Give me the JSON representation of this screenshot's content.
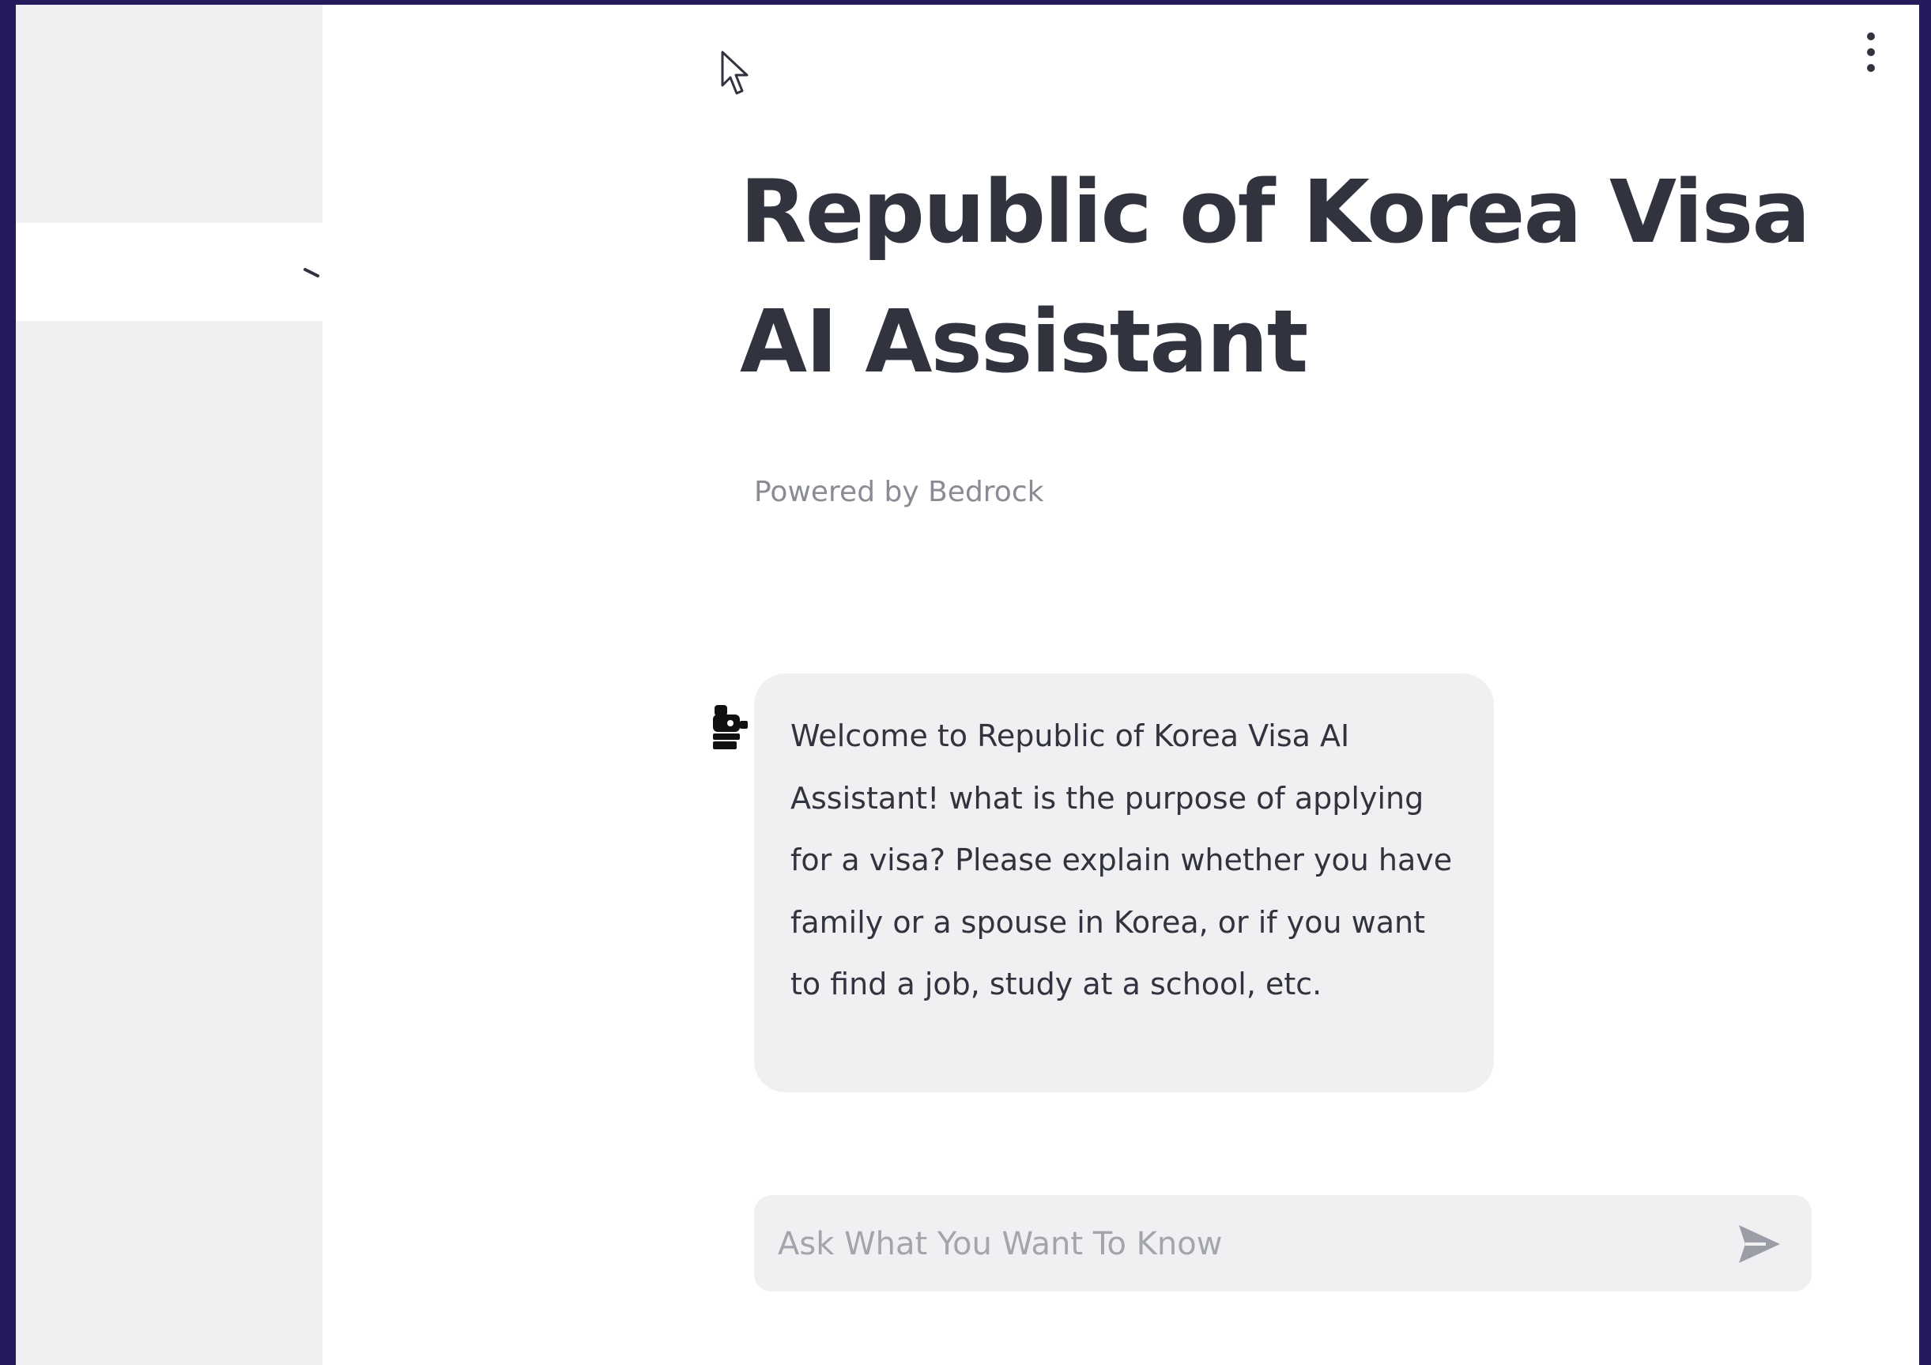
{
  "app": {
    "title": "Republic of Korea Visa AI Assistant",
    "subtitle": "Powered by Bedrock"
  },
  "sidebar": {
    "select_icon": "chevron-down-icon"
  },
  "header": {
    "menu_icon": "vertical-dots-icon"
  },
  "chat": {
    "messages": [
      {
        "role": "assistant",
        "avatar_icon": "robot-icon",
        "text": "Welcome to Republic of Korea Visa AI Assistant! what is the purpose of applying for a visa? Please explain whether you have family or a spouse in Korea, or if you want to find a job, study at a school, etc."
      }
    ],
    "input": {
      "placeholder": "Ask What You Want To Know",
      "value": "",
      "send_icon": "send-arrow-icon"
    }
  },
  "colors": {
    "frame_background": "#241a5c",
    "sidebar_background": "#f0f0f3",
    "text_primary": "#31333f",
    "text_muted": "#8a8c94",
    "bubble_background": "#f0f0f2"
  }
}
